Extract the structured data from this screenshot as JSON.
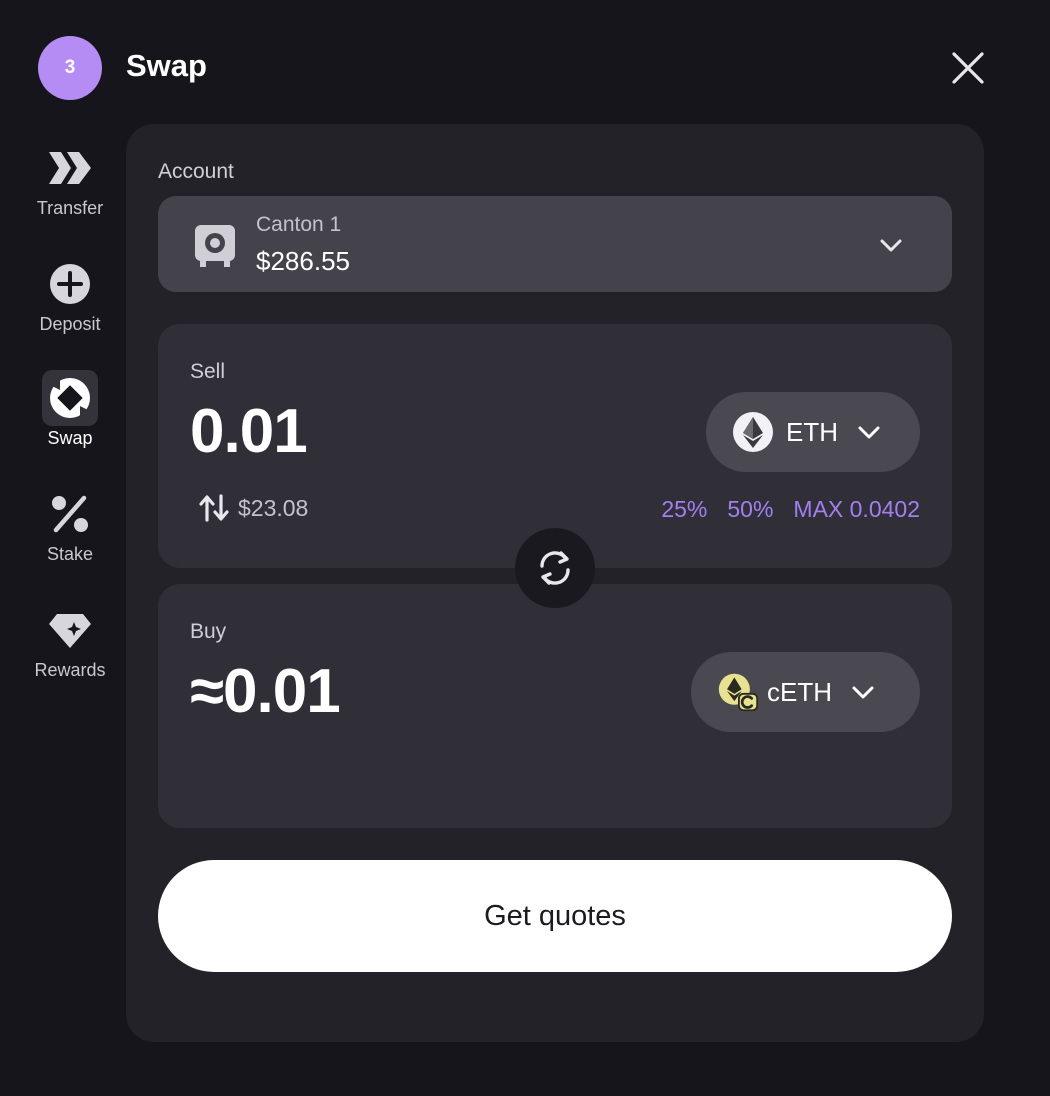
{
  "header": {
    "step": "3",
    "title": "Swap"
  },
  "sidebar": {
    "items": [
      {
        "label": "Transfer",
        "icon": "transfer-icon"
      },
      {
        "label": "Deposit",
        "icon": "plus-circle-icon"
      },
      {
        "label": "Swap",
        "icon": "swap-icon",
        "active": true
      },
      {
        "label": "Stake",
        "icon": "percent-icon"
      },
      {
        "label": "Rewards",
        "icon": "diamond-icon"
      }
    ]
  },
  "account": {
    "label": "Account",
    "name": "Canton 1",
    "balance": "$286.55"
  },
  "sell": {
    "label": "Sell",
    "amount": "0.01",
    "token": "ETH",
    "fiat_value": "$23.08",
    "presets": [
      "25%",
      "50%",
      "MAX 0.0402"
    ]
  },
  "buy": {
    "label": "Buy",
    "approx_symbol": "≈",
    "amount": "0.01",
    "token": "cETH"
  },
  "action": {
    "label": "Get quotes"
  },
  "colors": {
    "accent": "#b58cf4",
    "preset_text": "#a27ff0",
    "background": "#16151b",
    "panel": "#232229"
  }
}
